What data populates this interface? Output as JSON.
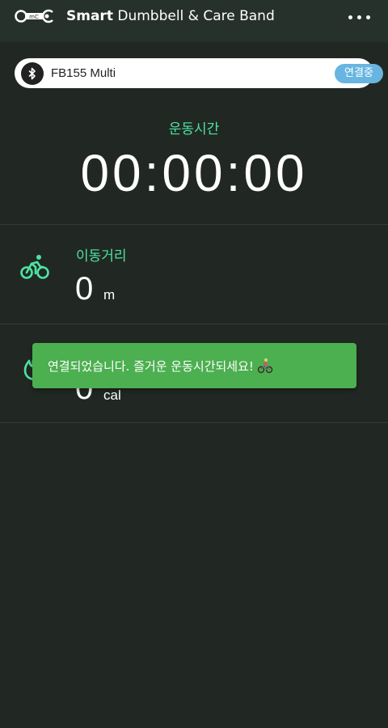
{
  "header": {
    "logo_text": "mC",
    "title_bold": "Smart",
    "title_rest": " Dumbbell & Care Band",
    "menu_icon": "more-horizontal-icon"
  },
  "device": {
    "icon": "bluetooth-icon",
    "name": "FB155 Multi",
    "status": "연결중"
  },
  "timer": {
    "label": "운동시간",
    "value": "00:00:00"
  },
  "stats": {
    "distance": {
      "icon": "bicycle-icon",
      "label": "이동거리",
      "value": "0",
      "unit": "m"
    },
    "calories": {
      "icon": "flame-icon",
      "value": "0",
      "unit": "cal"
    }
  },
  "toast": {
    "message": "연결되었습니다. 즐거운 운동시간되세요!",
    "emoji": "cyclist-emoji"
  },
  "colors": {
    "background": "#212823",
    "header": "#27312b",
    "accent": "#4ee3a2",
    "badge": "#67b5e0",
    "toast": "#4caf50"
  }
}
